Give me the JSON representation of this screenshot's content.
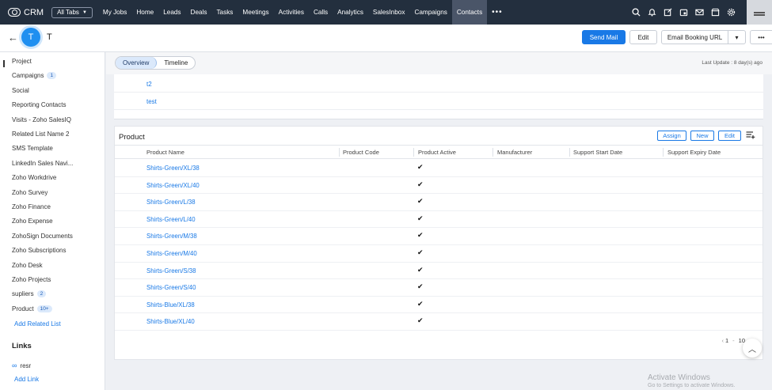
{
  "topnav": {
    "logo_text": "CRM",
    "all_tabs_label": "All Tabs",
    "tabs": [
      "My Jobs",
      "Home",
      "Leads",
      "Deals",
      "Tasks",
      "Meetings",
      "Activities",
      "Calls",
      "Analytics",
      "SalesInbox",
      "Campaigns",
      "Contacts"
    ],
    "active_tab": "Contacts",
    "more_label": "•••",
    "icons": [
      "search-icon",
      "bell-icon",
      "compose-icon",
      "calendar-icon",
      "mail-icon",
      "marketplace-icon",
      "gear-icon",
      "apps-icon"
    ]
  },
  "record": {
    "initial": "T",
    "title": "T",
    "send_mail_label": "Send Mail",
    "edit_label": "Edit",
    "email_booking_label": "Email Booking URL",
    "caret": "▾",
    "more_label": "•••"
  },
  "sidebar": {
    "items": [
      {
        "label": "Project"
      },
      {
        "label": "Campaigns",
        "badge": "1"
      },
      {
        "label": "Social"
      },
      {
        "label": "Reporting Contacts"
      },
      {
        "label": "Visits - Zoho SalesIQ"
      },
      {
        "label": "Related List Name 2"
      },
      {
        "label": "SMS Template"
      },
      {
        "label": "LinkedIn Sales Navi..."
      },
      {
        "label": "Zoho Workdrive"
      },
      {
        "label": "Zoho Survey"
      },
      {
        "label": "Zoho Finance"
      },
      {
        "label": "Zoho Expense"
      },
      {
        "label": "ZohoSign Documents"
      },
      {
        "label": "Zoho Subscriptions"
      },
      {
        "label": "Zoho Desk"
      },
      {
        "label": "Zoho Projects"
      },
      {
        "label": "supliers",
        "badge": "2"
      },
      {
        "label": "Product",
        "badge": "10+"
      }
    ],
    "add_related_list": "Add Related List",
    "links_heading": "Links",
    "link_item": "resr",
    "add_link": "Add Link"
  },
  "view": {
    "tabs": [
      "Overview",
      "Timeline"
    ],
    "active": "Overview",
    "last_update": "Last Update : 8 day(s) ago"
  },
  "notes_rows": [
    "t2",
    "test"
  ],
  "product": {
    "title": "Product",
    "assign_label": "Assign",
    "new_label": "New",
    "edit_label": "Edit",
    "columns": [
      "Product Name",
      "Product Code",
      "Product Active",
      "Manufacturer",
      "Support Start Date",
      "Support Expiry Date"
    ],
    "rows": [
      {
        "name": "Shirts-Green/XL/38",
        "active": "✔"
      },
      {
        "name": "Shirts-Green/XL/40",
        "active": "✔"
      },
      {
        "name": "Shirts-Green/L/38",
        "active": "✔"
      },
      {
        "name": "Shirts-Green/L/40",
        "active": "✔"
      },
      {
        "name": "Shirts-Green/M/38",
        "active": "✔"
      },
      {
        "name": "Shirts-Green/M/40",
        "active": "✔"
      },
      {
        "name": "Shirts-Green/S/38",
        "active": "✔"
      },
      {
        "name": "Shirts-Green/S/40",
        "active": "✔"
      },
      {
        "name": "Shirts-Blue/XL/38",
        "active": "✔"
      },
      {
        "name": "Shirts-Blue/XL/40",
        "active": "✔"
      }
    ],
    "pager_from": "1",
    "pager_sep": "-",
    "pager_to": "10"
  },
  "watermark": {
    "line1": "Activate Windows",
    "line2": "Go to Settings to activate Windows."
  },
  "colors": {
    "nav_bg": "#232f3e",
    "accent": "#1979e6",
    "avatar": "#1f8ff0"
  }
}
